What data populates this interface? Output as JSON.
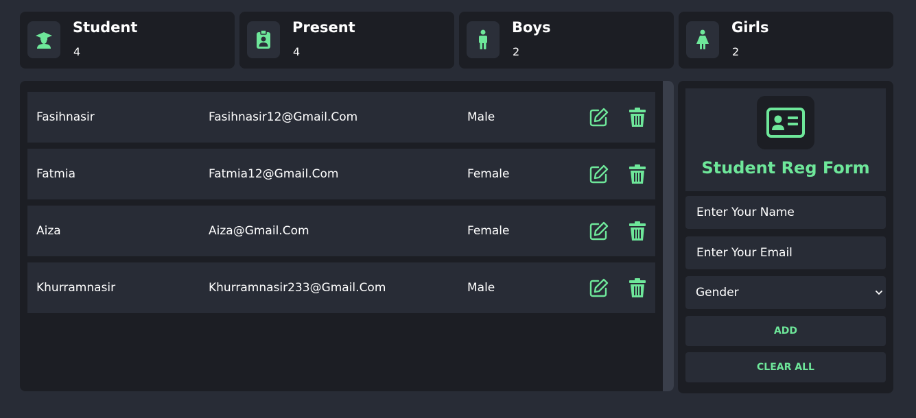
{
  "stats": [
    {
      "title": "Student",
      "value": "4",
      "icon": "graduate-icon"
    },
    {
      "title": "Present",
      "value": "4",
      "icon": "id-badge-icon"
    },
    {
      "title": "Boys",
      "value": "2",
      "icon": "male-person-icon"
    },
    {
      "title": "Girls",
      "value": "2",
      "icon": "female-person-icon"
    }
  ],
  "students": [
    {
      "name": "Fasihnasir",
      "email": "Fasihnasir12@Gmail.Com",
      "gender": "Male"
    },
    {
      "name": "Fatmia",
      "email": "Fatmia12@Gmail.Com",
      "gender": "Female"
    },
    {
      "name": "Aiza",
      "email": "Aiza@Gmail.Com",
      "gender": "Female"
    },
    {
      "name": "Khurramnasir",
      "email": "Khurramnasir233@Gmail.Com",
      "gender": "Male"
    }
  ],
  "form": {
    "title": "Student Reg Form",
    "name_placeholder": "Enter Your Name",
    "email_placeholder": "Enter Your Email",
    "gender_selected": "Gender",
    "add_label": "ADD",
    "clear_label": "CLEAR ALL"
  },
  "colors": {
    "accent": "#6ee79a",
    "page_bg": "#282c36",
    "panel_bg": "#1c1e24"
  }
}
